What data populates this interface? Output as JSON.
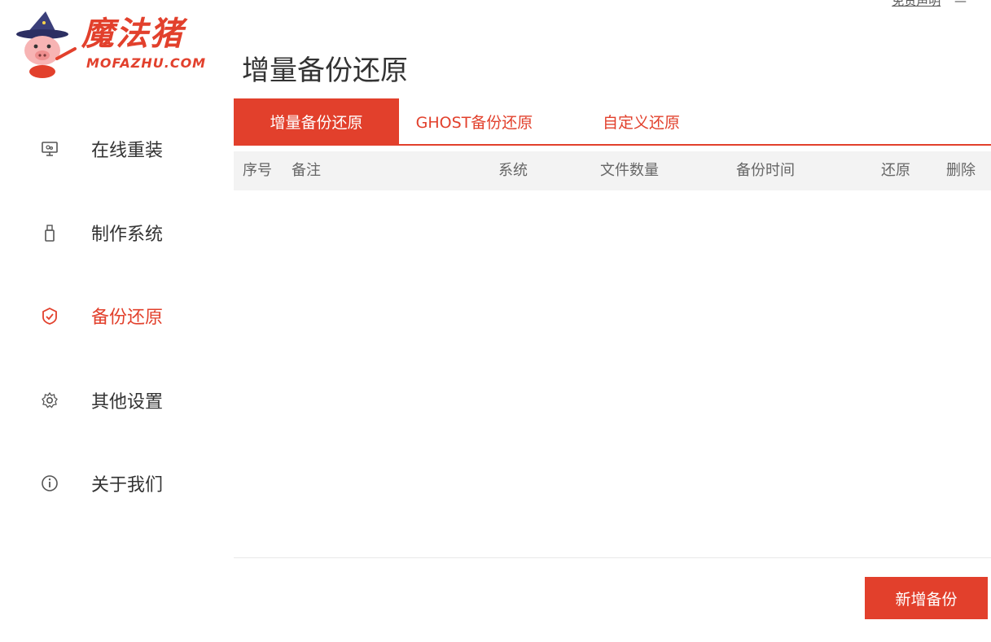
{
  "brand": {
    "name_cn": "魔法猪",
    "name_en": "MOFAZHU.COM"
  },
  "header": {
    "title": "增量备份还原",
    "disclaimer_link": "免责声明",
    "minimize_label": "—"
  },
  "sidebar": {
    "items": [
      {
        "label": "在线重装",
        "icon": "monitor-icon",
        "active": false
      },
      {
        "label": "制作系统",
        "icon": "usb-icon",
        "active": false
      },
      {
        "label": "备份还原",
        "icon": "backup-icon",
        "active": true
      },
      {
        "label": "其他设置",
        "icon": "gear-icon",
        "active": false
      },
      {
        "label": "关于我们",
        "icon": "info-icon",
        "active": false
      }
    ]
  },
  "tabs": [
    {
      "label": "增量备份还原",
      "active": true
    },
    {
      "label": "GHOST备份还原",
      "active": false
    },
    {
      "label": "自定义还原",
      "active": false
    }
  ],
  "table": {
    "columns": [
      "序号",
      "备注",
      "系统",
      "文件数量",
      "备份时间",
      "还原",
      "删除"
    ],
    "rows": []
  },
  "actions": {
    "add_backup_label": "新增备份"
  },
  "colors": {
    "accent": "#e2402c",
    "header_bg": "#f3f3f3"
  }
}
